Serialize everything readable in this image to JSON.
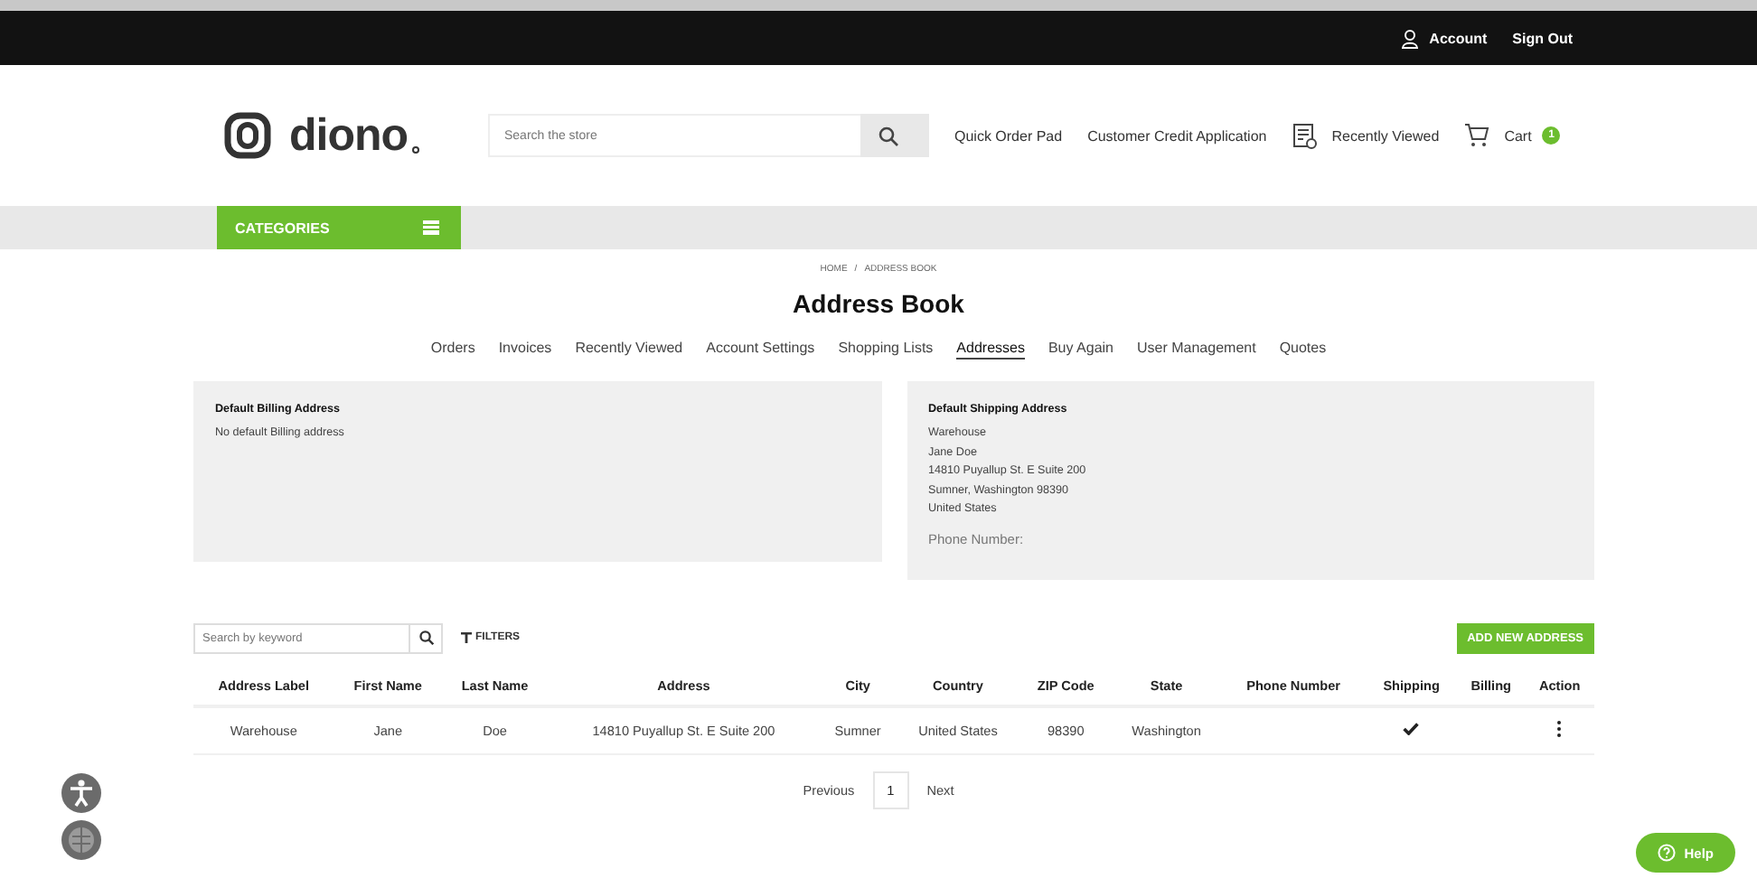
{
  "top_bar": {
    "account": "Account",
    "sign_out": "Sign Out"
  },
  "header": {
    "logo": "diono",
    "search": {
      "placeholder": "Search the store"
    },
    "links": [
      "Quick Order Pad",
      "Customer Credit Application"
    ],
    "recently_viewed": "Recently Viewed",
    "cart": "Cart",
    "cart_count": "1"
  },
  "categories": "CATEGORIES",
  "breadcrumb": [
    "HOME",
    "/",
    "ADDRESS BOOK"
  ],
  "title": "Address Book",
  "tabs": [
    {
      "label": "Orders",
      "selected": false
    },
    {
      "label": "Invoices",
      "selected": false
    },
    {
      "label": "Recently Viewed",
      "selected": false
    },
    {
      "label": "Account Settings",
      "selected": false
    },
    {
      "label": "Shopping Lists",
      "selected": false
    },
    {
      "label": "Addresses",
      "selected": true
    },
    {
      "label": "Buy Again",
      "selected": false
    },
    {
      "label": "User Management",
      "selected": false
    },
    {
      "label": "Quotes",
      "selected": false
    }
  ],
  "billing": {
    "heading": "Default Billing Address",
    "lines": [
      "No default Billing address"
    ]
  },
  "shipping": {
    "heading": "Default Shipping Address",
    "lines": [
      "Warehouse",
      "Jane Doe",
      "14810 Puyallup St. E Suite 200",
      "Sumner, Washington 98390",
      "United States"
    ],
    "phone": "Phone Number:"
  },
  "toolbar": {
    "search": {
      "placeholder": "Search by keyword"
    },
    "filters": "FILTERS",
    "add": "ADD NEW ADDRESS"
  },
  "table": {
    "columns": [
      "Address Label",
      "First Name",
      "Last Name",
      "Address",
      "City",
      "Country",
      "ZIP Code",
      "State",
      "Phone Number",
      "Shipping",
      "Billing",
      "Action"
    ],
    "rows": [
      {
        "cells": [
          "Warehouse",
          "Jane",
          "Doe",
          "14810 Puyallup St. E Suite 200",
          "Sumner",
          "United States",
          "98390",
          "Washington",
          ""
        ],
        "shipping": true,
        "billing": false
      }
    ]
  },
  "pagination": {
    "previous": "Previous",
    "pages": [
      {
        "label": "1",
        "selected": true
      }
    ],
    "next": "Next"
  },
  "help": "Help"
}
